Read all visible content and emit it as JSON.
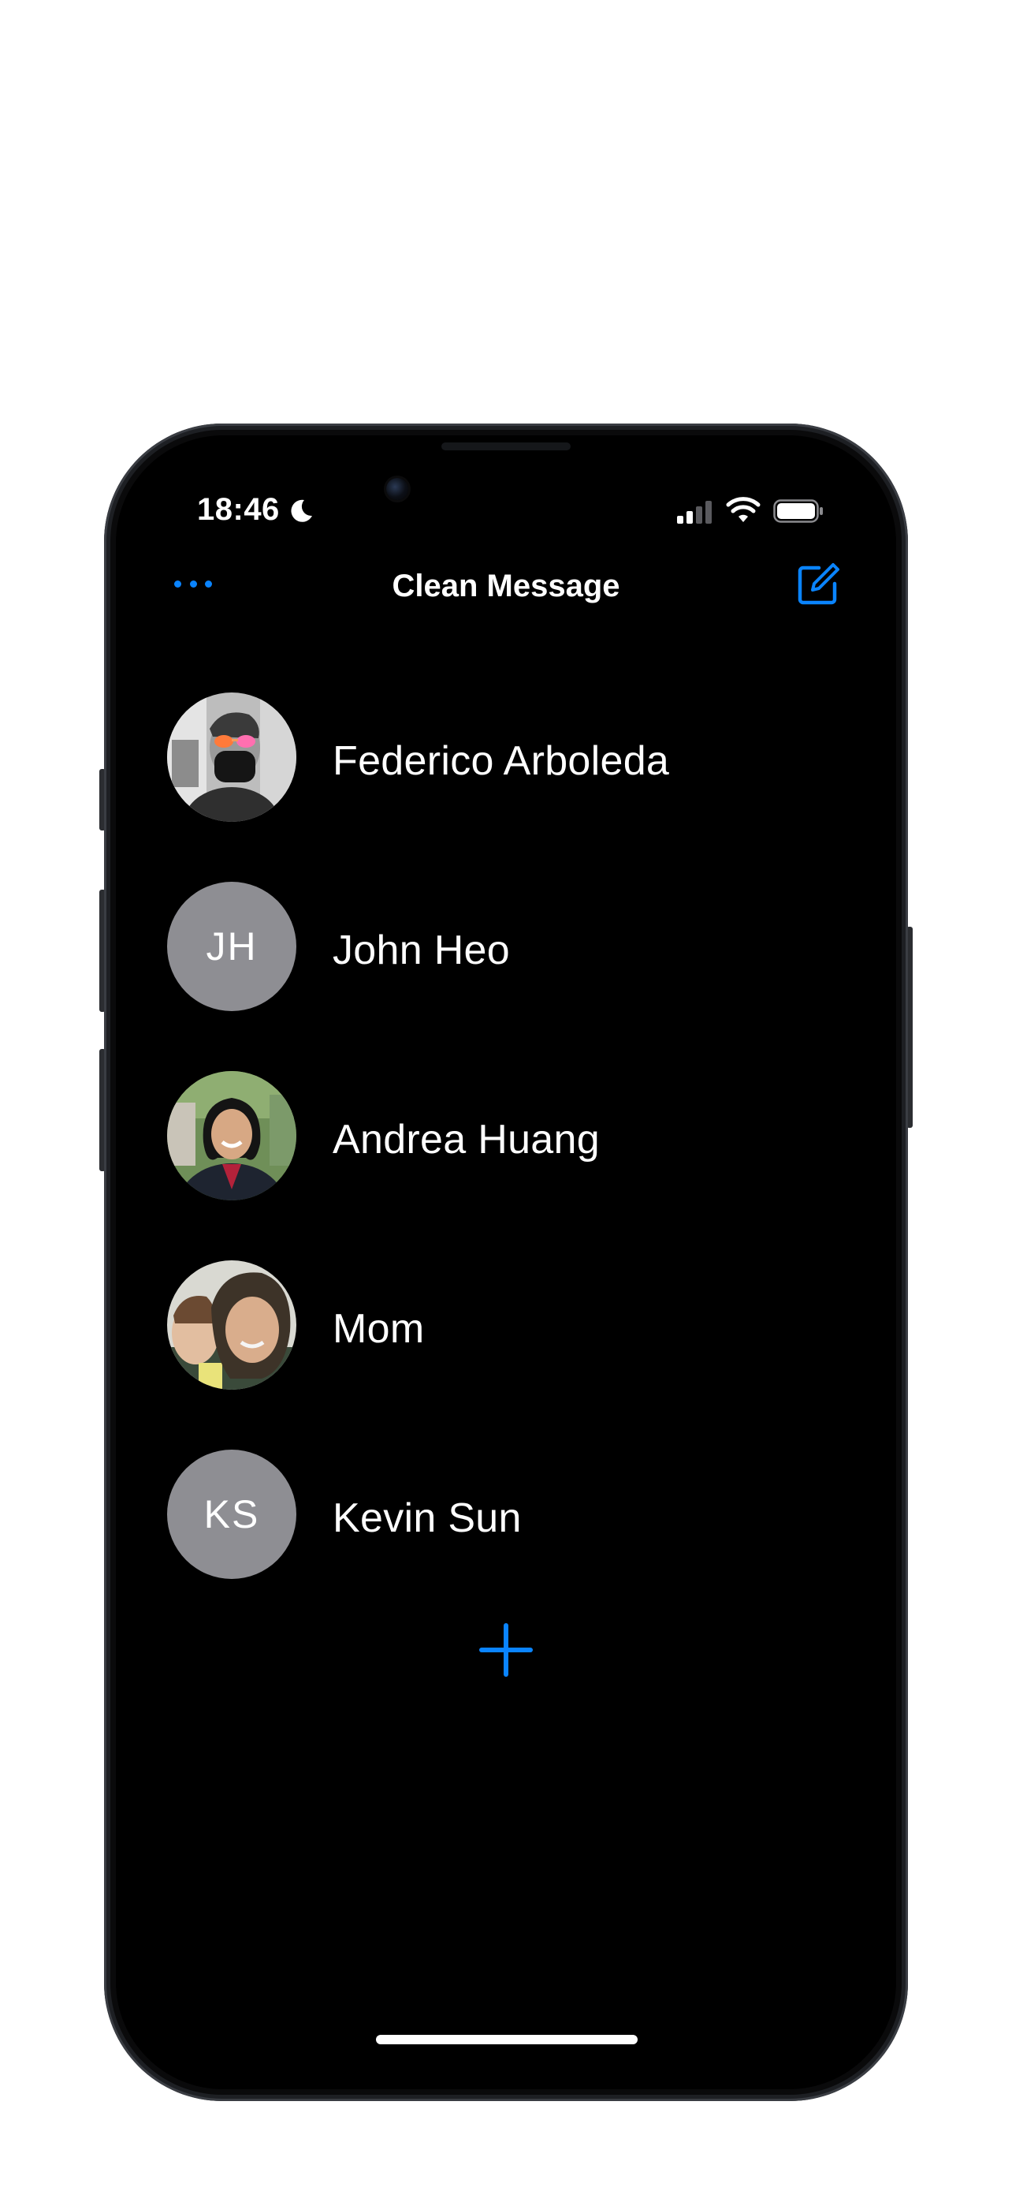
{
  "status_bar": {
    "time": "18:46",
    "focus_icon": "moon-icon",
    "signal_icon": "cellular-signal-icon",
    "wifi_icon": "wifi-icon",
    "battery_icon": "battery-icon"
  },
  "nav": {
    "title": "Clean Message",
    "left_icon": "more-ellipsis-icon",
    "right_icon": "compose-icon"
  },
  "contacts": [
    {
      "name": "Federico Arboleda",
      "avatar_type": "photo"
    },
    {
      "name": "John Heo",
      "avatar_type": "initials",
      "initials": "JH"
    },
    {
      "name": "Andrea Huang",
      "avatar_type": "photo"
    },
    {
      "name": "Mom",
      "avatar_type": "photo"
    },
    {
      "name": "Kevin Sun",
      "avatar_type": "initials",
      "initials": "KS"
    }
  ],
  "add_icon": "plus-icon",
  "colors": {
    "accent": "#0a84ff",
    "background": "#000000",
    "initials_avatar": "#8e8e93",
    "text": "#ffffff"
  }
}
